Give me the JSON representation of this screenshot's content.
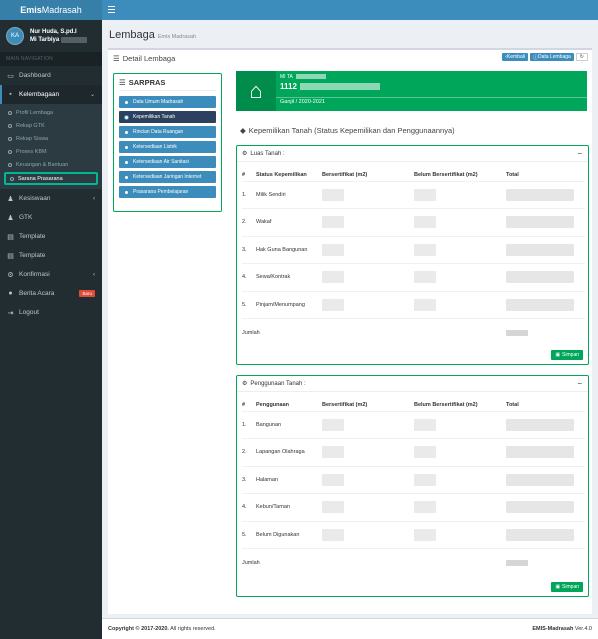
{
  "brand": {
    "bold": "Emis",
    "light": "Madrasah"
  },
  "user": {
    "initials": "KA",
    "name": "Nur Huda, S.pd.I",
    "unit": "Mi Tarbiya"
  },
  "nav_header": "MAIN NAVIGATION",
  "nav": {
    "dashboard": "Dashboard",
    "kelembagaan": "Kelembagaan",
    "sub": [
      "Profil Lembaga",
      "Rekap GTK",
      "Rekap Siswa",
      "Proses KBM",
      "Keuangan & Bantuan",
      "Sarana Prasarana"
    ],
    "kesiswaan": "Kesiswaan",
    "gtk": "GTK",
    "template1": "Template",
    "template2": "Template",
    "konfirmasi": "Konfirmasi",
    "berita": "Berita Acara",
    "berita_badge": "Baru",
    "logout": "Logout"
  },
  "page": {
    "title": "Lembaga",
    "subtitle": "Emis Madrasah"
  },
  "box": {
    "title": "Detail Lembaga",
    "btn_back": "Kembali",
    "btn_data": "Data Lembaga"
  },
  "sarpras": {
    "title": "SARPRAS",
    "items": [
      "Data Umum Madrasah",
      "Kepemilikan Tanah",
      "Rincian Data Ruangan",
      "Ketersediaan Listrik",
      "Ketersediaan Air Sanitasi",
      "Ketersediaan Jaringan Internet",
      "Prasarana Pembelajaran"
    ]
  },
  "school": {
    "label": "MI TA",
    "nsm": "1112",
    "period": "Ganjil / 2020-2021"
  },
  "section_title": "Kepemilikan Tanah (Status Kepemilikan dan Penggunaannya)",
  "luas": {
    "title": "Luas Tanah :",
    "headers": [
      "#",
      "Status Kepemilikan",
      "Bersertifikat (m2)",
      "Belum Bersertifikat (m2)",
      "Total"
    ],
    "rows": [
      {
        "no": "1.",
        "label": "Milik Sendiri"
      },
      {
        "no": "2.",
        "label": "Wakaf"
      },
      {
        "no": "3.",
        "label": "Hak Guna Bangunan"
      },
      {
        "no": "4.",
        "label": "Sewa/Kontrak"
      },
      {
        "no": "5.",
        "label": "Pinjam/Menumpang"
      }
    ],
    "jumlah": "Jumlah",
    "save": "Simpan"
  },
  "penggunaan": {
    "title": "Penggunaan Tanah :",
    "headers": [
      "#",
      "Penggunaan",
      "Bersertifikat (m2)",
      "Belum Bersertifikat (m2)",
      "Total"
    ],
    "rows": [
      {
        "no": "1.",
        "label": "Bangunan"
      },
      {
        "no": "2.",
        "label": "Lapangan Olahraga"
      },
      {
        "no": "3.",
        "label": "Halaman"
      },
      {
        "no": "4.",
        "label": "Kebun/Taman"
      },
      {
        "no": "5.",
        "label": "Belum Digunakan"
      }
    ],
    "jumlah": "Jumlah",
    "save": "Simpan"
  },
  "footer": {
    "copyright": "Copyright © 2017-2020.",
    "rights": "All rights reserved.",
    "app": "EMIS-Madrasah",
    "version": "Ver.4.0"
  }
}
